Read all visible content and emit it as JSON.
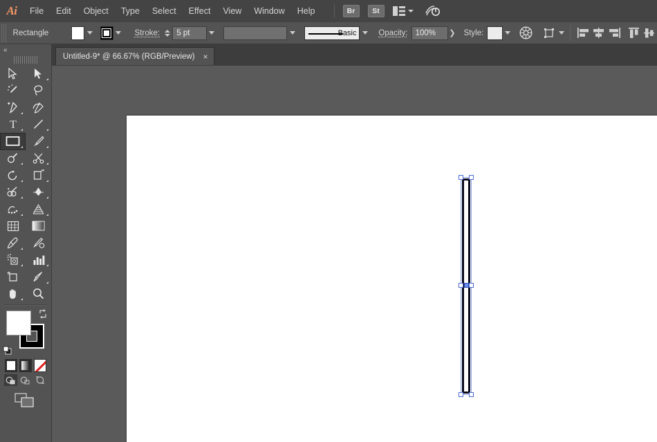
{
  "app": {
    "name": "Adobe Illustrator",
    "logo_text": "Ai"
  },
  "menubar": {
    "items": [
      {
        "label": "File"
      },
      {
        "label": "Edit"
      },
      {
        "label": "Object"
      },
      {
        "label": "Type"
      },
      {
        "label": "Select"
      },
      {
        "label": "Effect"
      },
      {
        "label": "View"
      },
      {
        "label": "Window"
      },
      {
        "label": "Help"
      }
    ],
    "bridge_button": "Br",
    "stock_button": "St",
    "arrange_icon": "arrange-documents-icon",
    "workspace_chevron": "chevron-down-icon",
    "sync_icon": "sync-settings-icon"
  },
  "controlbar": {
    "object_label": "Rectangle",
    "fill_label": "Fill",
    "fill_color": "#ffffff",
    "stroke_swatch_label": "Stroke color",
    "stroke_color": "#000000",
    "stroke_label": "Stroke:",
    "stroke_weight": "5 pt",
    "variable_width_label": "Variable Width Profile",
    "variable_width_value": "",
    "brush_label": "Brush Definition",
    "brush_value": "Basic",
    "opacity_label": "Opacity:",
    "opacity_value": "100%",
    "style_label": "Style:",
    "style_value": "",
    "recolor_icon": "recolor-artwork-icon",
    "transform_icon": "transform-panel-icon",
    "align_icons": [
      "align-left-icon",
      "align-horizontal-center-icon",
      "align-right-icon",
      "align-top-icon",
      "align-vertical-center-icon"
    ]
  },
  "tabbar": {
    "tab_title": "Untitled-9* @ 66.67% (RGB/Preview)",
    "close_label": "×"
  },
  "toolbar": {
    "collapse_label": "«",
    "tools": [
      {
        "name": "selection-tool",
        "has_flyout": false
      },
      {
        "name": "direct-selection-tool",
        "has_flyout": true
      },
      {
        "name": "magic-wand-tool",
        "has_flyout": false
      },
      {
        "name": "lasso-tool",
        "has_flyout": false
      },
      {
        "name": "pen-tool",
        "has_flyout": true
      },
      {
        "name": "curvature-tool",
        "has_flyout": false
      },
      {
        "name": "type-tool",
        "has_flyout": true
      },
      {
        "name": "line-segment-tool",
        "has_flyout": true
      },
      {
        "name": "rectangle-tool",
        "has_flyout": true,
        "selected": true
      },
      {
        "name": "paintbrush-tool",
        "has_flyout": true
      },
      {
        "name": "shaper-tool",
        "has_flyout": true
      },
      {
        "name": "scissors-tool",
        "has_flyout": true
      },
      {
        "name": "rotate-tool",
        "has_flyout": true
      },
      {
        "name": "free-transform-tool",
        "has_flyout": true
      },
      {
        "name": "shape-builder-tool",
        "has_flyout": true
      },
      {
        "name": "width-tool",
        "has_flyout": true
      },
      {
        "name": "blend-tool",
        "has_flyout": true
      },
      {
        "name": "perspective-grid-tool",
        "has_flyout": true
      },
      {
        "name": "mesh-tool",
        "has_flyout": false
      },
      {
        "name": "gradient-tool",
        "has_flyout": false
      },
      {
        "name": "eyedropper-tool",
        "has_flyout": true
      },
      {
        "name": "blob-brush-tool",
        "has_flyout": false
      },
      {
        "name": "symbol-sprayer-tool",
        "has_flyout": true
      },
      {
        "name": "column-graph-tool",
        "has_flyout": true
      },
      {
        "name": "artboard-tool",
        "has_flyout": false
      },
      {
        "name": "slice-tool",
        "has_flyout": true
      },
      {
        "name": "hand-tool",
        "has_flyout": true
      },
      {
        "name": "zoom-tool",
        "has_flyout": false
      }
    ],
    "fill_color": "#ffffff",
    "stroke_color": "#000000",
    "swap_icon": "swap-fill-stroke-icon",
    "default_icon": "default-fill-stroke-icon",
    "color_mode_buttons": [
      {
        "name": "color-button"
      },
      {
        "name": "gradient-button"
      },
      {
        "name": "none-button"
      }
    ],
    "draw_mode_buttons": [
      {
        "name": "draw-normal-button",
        "active": true
      },
      {
        "name": "draw-behind-button",
        "active": false
      },
      {
        "name": "draw-inside-button",
        "active": false
      }
    ],
    "screen_mode_button": "change-screen-mode-icon"
  },
  "canvas": {
    "artboard_background": "#ffffff",
    "canvas_background": "#5a5a5a",
    "selection_color": "#8fa6e8",
    "shape": {
      "name": "rectangle",
      "fill": "#ffffff",
      "stroke": "#000000",
      "stroke_weight": "5 pt",
      "selected": true
    }
  }
}
